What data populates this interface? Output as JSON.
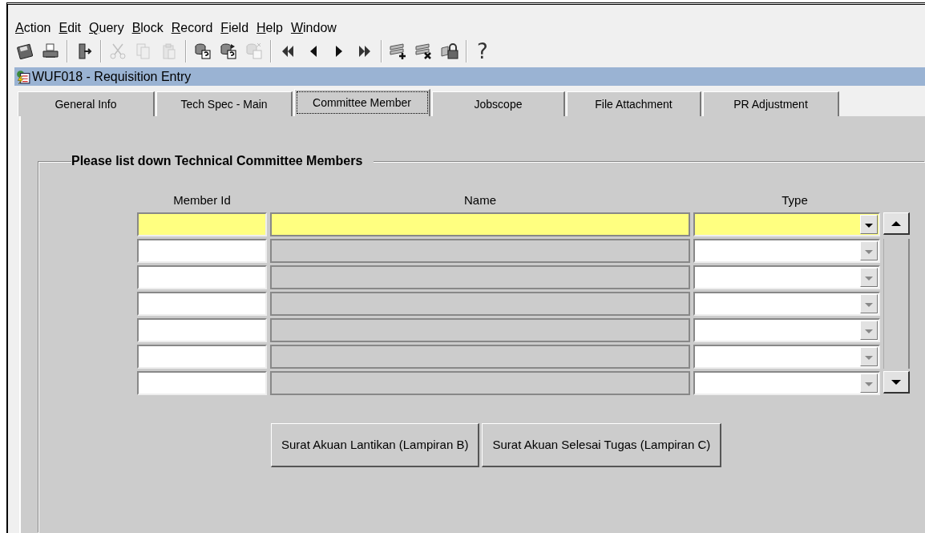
{
  "menu": [
    "Action",
    "Edit",
    "Query",
    "Block",
    "Record",
    "Field",
    "Help",
    "Window"
  ],
  "toolbar": [
    {
      "kind": "save",
      "disabled": false
    },
    {
      "kind": "print",
      "disabled": false
    },
    {
      "kind": "sep"
    },
    {
      "kind": "exit",
      "disabled": false
    },
    {
      "kind": "sep"
    },
    {
      "kind": "cut",
      "disabled": true
    },
    {
      "kind": "copy",
      "disabled": true
    },
    {
      "kind": "paste",
      "disabled": true
    },
    {
      "kind": "sep"
    },
    {
      "kind": "query",
      "disabled": false
    },
    {
      "kind": "execute",
      "disabled": false
    },
    {
      "kind": "cancel",
      "disabled": true
    },
    {
      "kind": "sep"
    },
    {
      "kind": "first",
      "disabled": false
    },
    {
      "kind": "prev",
      "disabled": false
    },
    {
      "kind": "next",
      "disabled": false
    },
    {
      "kind": "last",
      "disabled": false
    },
    {
      "kind": "sep"
    },
    {
      "kind": "insert",
      "disabled": false
    },
    {
      "kind": "delete",
      "disabled": false
    },
    {
      "kind": "lock",
      "disabled": false
    },
    {
      "kind": "sep"
    },
    {
      "kind": "help",
      "label": "?",
      "disabled": false
    }
  ],
  "window": {
    "title": "WUF018 - Requisition Entry"
  },
  "tabs": [
    {
      "label": "General Info",
      "selected": false
    },
    {
      "label": "Tech Spec - Main",
      "selected": false
    },
    {
      "label": "Committee Member",
      "selected": true
    },
    {
      "label": "Jobscope",
      "selected": false
    },
    {
      "label": "File Attachment",
      "selected": false
    },
    {
      "label": "PR Adjustment",
      "selected": false
    }
  ],
  "group": {
    "title": "Please list down Technical Committee Members"
  },
  "table": {
    "columns": [
      "Member Id",
      "Name",
      "Type"
    ],
    "rows": [
      {
        "selected": true
      },
      {
        "selected": false
      },
      {
        "selected": false
      },
      {
        "selected": false
      },
      {
        "selected": false
      },
      {
        "selected": false
      },
      {
        "selected": false
      }
    ]
  },
  "buttons": [
    "Surat Akuan Lantikan (Lampiran B)",
    "Surat Akuan Selesai Tugas (Lampiran C)"
  ]
}
